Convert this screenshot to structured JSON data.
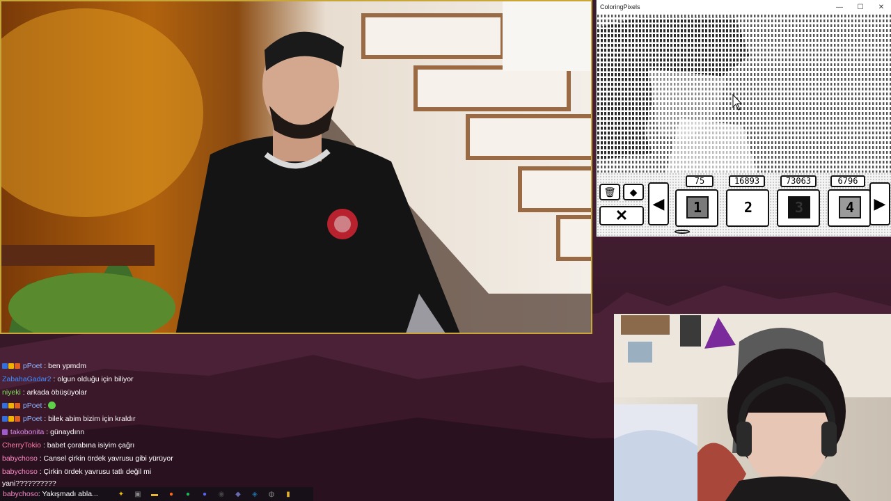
{
  "coloring_pixels": {
    "title": "ColoringPixels",
    "window_controls": [
      "—",
      "☐",
      "✕"
    ],
    "tools": {
      "trash_icon": "trash-icon",
      "eraser_icon": "eraser-icon",
      "close_label": "✕"
    },
    "colors": [
      {
        "count": "75",
        "number": "1",
        "swatch": "#7a7a7a",
        "fg": "#111111"
      },
      {
        "count": "16893",
        "number": "2",
        "swatch": "#ffffff",
        "fg": "#111111"
      },
      {
        "count": "73063",
        "number": "3",
        "swatch": "#111111",
        "fg": "#333333"
      },
      {
        "count": "6796",
        "number": "4",
        "swatch": "#9a9a9a",
        "fg": "#111111"
      }
    ],
    "prev_arrow": "◀",
    "next_arrow": "▶"
  },
  "chat": [
    {
      "badges": [
        "#2f6fe0",
        "#f0b400",
        "#e06020"
      ],
      "user": "pPoet",
      "user_color": "#8fb4ff",
      "message": ": ben ypmdm"
    },
    {
      "badges": [],
      "user": "ZabahaGadar2",
      "user_color": "#3f8cff",
      "message": ": olgun olduğu için biliyor"
    },
    {
      "badges": [],
      "user": "niyeki",
      "user_color": "#7ee05a",
      "message": ": arkada öbüşüyolar"
    },
    {
      "badges": [
        "#2f6fe0",
        "#f0b400",
        "#e06020"
      ],
      "user": "pPoet",
      "user_color": "#8fb4ff",
      "message": ": ",
      "emote": true
    },
    {
      "badges": [
        "#2f6fe0",
        "#f0b400",
        "#e06020"
      ],
      "user": "pPoet",
      "user_color": "#8fb4ff",
      "message": ": bilek abim bizim için kraldır"
    },
    {
      "badges": [
        "#a05ad0"
      ],
      "user": "takobonita",
      "user_color": "#d58ae8",
      "message": ": günaydınn"
    },
    {
      "badges": [],
      "user": "CherryTokio",
      "user_color": "#ff7fa8",
      "message": ": babet çorabına isiyim çağrı"
    },
    {
      "badges": [],
      "user": "babychoso",
      "user_color": "#ff88c4",
      "message": ": Cansel çirkin ördek yavrusu gibi yürüyor"
    },
    {
      "badges": [],
      "user": "babychoso",
      "user_color": "#ff88c4",
      "message": ": Çirkin ördek yavrusu tatlı değil mi"
    }
  ],
  "chat_wrap": "yani??????????",
  "taskbar": {
    "chat_user": "babychoso",
    "chat_message": ": Yakışmadı abla...",
    "icons": [
      {
        "name": "sparkle-icon",
        "glyph": "✦",
        "color": "#f0c000"
      },
      {
        "name": "task-view-icon",
        "glyph": "▣",
        "color": "#888888"
      },
      {
        "name": "file-explorer-icon",
        "glyph": "▬",
        "color": "#e8b830"
      },
      {
        "name": "firefox-icon",
        "glyph": "●",
        "color": "#ff6a1f"
      },
      {
        "name": "spotify-icon",
        "glyph": "●",
        "color": "#1db954"
      },
      {
        "name": "discord-icon",
        "glyph": "●",
        "color": "#5865f2"
      },
      {
        "name": "obs-icon",
        "glyph": "◉",
        "color": "#444444"
      },
      {
        "name": "shield-icon",
        "glyph": "◆",
        "color": "#6a6ab0"
      },
      {
        "name": "steam-icon",
        "glyph": "◈",
        "color": "#1b6fa8"
      },
      {
        "name": "globe-icon",
        "glyph": "◍",
        "color": "#888888"
      },
      {
        "name": "app-icon",
        "glyph": "▮",
        "color": "#e0b030"
      }
    ]
  }
}
